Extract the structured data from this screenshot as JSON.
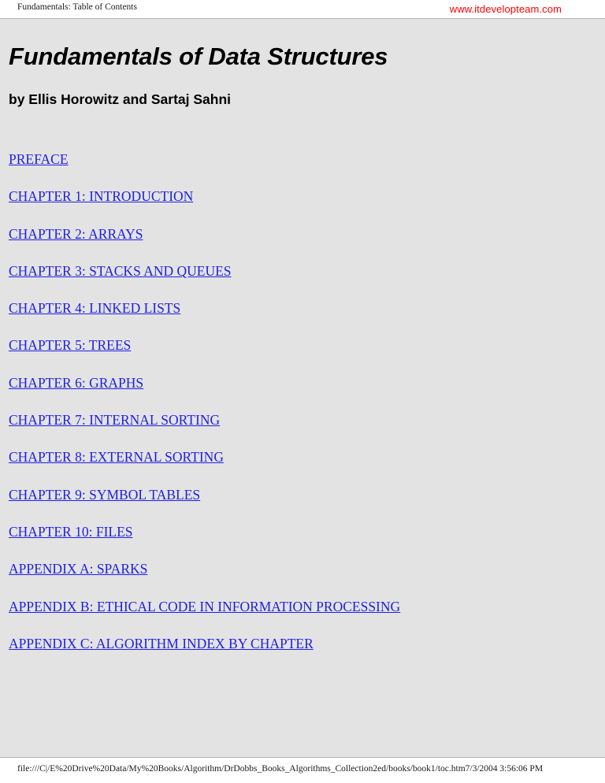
{
  "header": {
    "title": "Fundamentals: Table of Contents",
    "watermark": "www.itdevelopteam.com",
    "watermark_color": "#ff0000"
  },
  "document": {
    "title": "Fundamentals of Data Structures",
    "byline": "by Ellis Horowitz and Sartaj Sahni",
    "link_color": "#2020e0",
    "background_color": "#e3e3e3"
  },
  "toc": {
    "entries": [
      {
        "label": "PREFACE"
      },
      {
        "label": "CHAPTER 1: INTRODUCTION"
      },
      {
        "label": "CHAPTER 2: ARRAYS"
      },
      {
        "label": "CHAPTER 3: STACKS AND QUEUES"
      },
      {
        "label": "CHAPTER 4: LINKED LISTS"
      },
      {
        "label": "CHAPTER 5: TREES"
      },
      {
        "label": "CHAPTER 6: GRAPHS"
      },
      {
        "label": "CHAPTER 7: INTERNAL SORTING"
      },
      {
        "label": "CHAPTER 8: EXTERNAL SORTING"
      },
      {
        "label": "CHAPTER 9: SYMBOL TABLES"
      },
      {
        "label": "CHAPTER 10: FILES"
      },
      {
        "label": "APPENDIX A: SPARKS"
      },
      {
        "label": "APPENDIX B: ETHICAL CODE IN INFORMATION PROCESSING"
      },
      {
        "label": "APPENDIX C: ALGORITHM INDEX BY CHAPTER"
      }
    ]
  },
  "footer": {
    "path": "file:///C|/E%20Drive%20Data/My%20Books/Algorithm/DrDobbs_Books_Algorithms_Collection2ed/books/book1/toc.htm7/3/2004 3:56:06 PM"
  }
}
